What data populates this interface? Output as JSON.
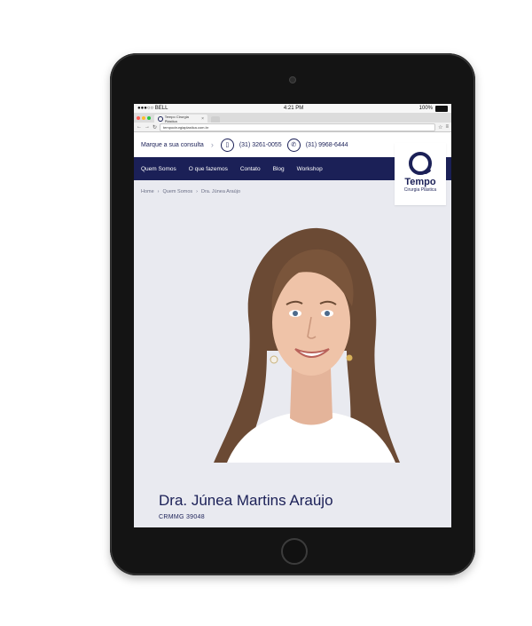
{
  "device": {
    "carrier": "●●●○○ BELL",
    "time": "4:21 PM",
    "battery": "100%"
  },
  "browser": {
    "tab_title": "Tempo Cirurgia Plástica",
    "url": "tempocirurgiaplastica.com.br"
  },
  "header": {
    "cta": "Marque a sua consulta",
    "phone": "(31) 3261-0055",
    "whatsapp": "(31) 9968-6444"
  },
  "nav": {
    "items": [
      {
        "label": "Quem Somos"
      },
      {
        "label": "O que fazemos"
      },
      {
        "label": "Contato"
      },
      {
        "label": "Blog"
      },
      {
        "label": "Workshop"
      }
    ]
  },
  "logo": {
    "name": "Tempo",
    "tagline": "Cirurgia Plástica"
  },
  "breadcrumb": [
    "Home",
    "Quem Somos",
    "Dra. Júnea Araújo"
  ],
  "profile": {
    "name": "Dra. Júnea Martins Araújo",
    "registration": "CRMMG 39048"
  },
  "colors": {
    "brand": "#1b2057",
    "page_bg": "#e9eaf0"
  }
}
